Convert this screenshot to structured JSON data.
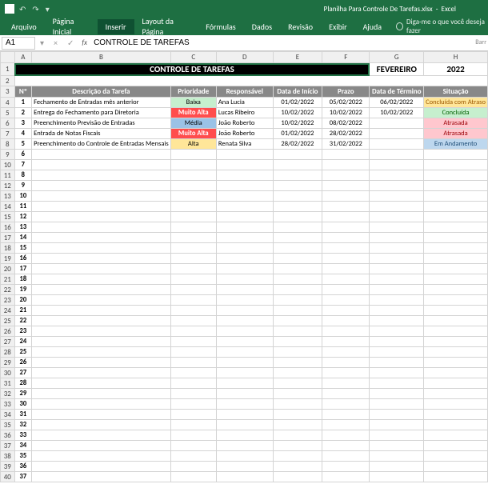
{
  "app": {
    "title_file": "Planilha Para Controle De Tarefas.xlsx",
    "title_app": "Excel"
  },
  "ribbon": {
    "tabs": [
      "Arquivo",
      "Página Inicial",
      "Inserir",
      "Layout da Página",
      "Fórmulas",
      "Dados",
      "Revisão",
      "Exibir",
      "Ajuda"
    ],
    "tell_me": "Diga-me o que você deseja fazer"
  },
  "formula_bar": {
    "name_box": "A1",
    "fx": "fx",
    "value": "CONTROLE DE TAREFAS"
  },
  "columns": [
    "A",
    "B",
    "C",
    "D",
    "E",
    "F",
    "G",
    "H"
  ],
  "sheet_title": "CONTROLE DE TAREFAS",
  "month": "FEVEREIRO",
  "year": "2022",
  "headers": {
    "num": "Nº",
    "desc": "Descrição da Tarefa",
    "prio": "Prioridade",
    "resp": "Responsável",
    "inicio": "Data de Início",
    "prazo": "Prazo",
    "termino": "Data de Término",
    "situacao": "Situação"
  },
  "rows": [
    {
      "n": "1",
      "desc": "Fechamento de Entradas mês anterior",
      "prio": "Baixa",
      "prio_cls": "prio-baixa",
      "resp": "Ana Lucia",
      "inicio": "01/02/2022",
      "prazo": "05/02/2022",
      "termino": "06/02/2022",
      "sit": "Concluída com Atraso",
      "sit_cls": "sit-concl-atraso"
    },
    {
      "n": "2",
      "desc": "Entrega do Fechamento para Diretoria",
      "prio": "Muito Alta",
      "prio_cls": "prio-muitoalta",
      "resp": "Lucas Ribeiro",
      "inicio": "10/02/2022",
      "prazo": "10/02/2022",
      "termino": "10/02/2022",
      "sit": "Concluída",
      "sit_cls": "sit-concluida"
    },
    {
      "n": "3",
      "desc": "Preenchimento Previsão de Entradas",
      "prio": "Média",
      "prio_cls": "prio-media",
      "resp": "João Roberto",
      "inicio": "10/02/2022",
      "prazo": "08/02/2022",
      "termino": "",
      "sit": "Atrasada",
      "sit_cls": "sit-atrasada"
    },
    {
      "n": "4",
      "desc": "Entrada de Notas Fiscais",
      "prio": "Muito Alta",
      "prio_cls": "prio-muitoalta",
      "resp": "João Roberto",
      "inicio": "01/02/2022",
      "prazo": "28/02/2022",
      "termino": "",
      "sit": "Atrasada",
      "sit_cls": "sit-atrasada"
    },
    {
      "n": "5",
      "desc": "Preenchimento do Controle de Entradas Mensais",
      "prio": "Alta",
      "prio_cls": "prio-alta",
      "resp": "Renata Silva",
      "inicio": "28/02/2022",
      "prazo": "31/02/2022",
      "termino": "",
      "sit": "Em Andamento",
      "sit_cls": "sit-andamento"
    }
  ],
  "empty_rows_start": 9,
  "empty_rows_end": 40,
  "sidebar_text": "Barr"
}
